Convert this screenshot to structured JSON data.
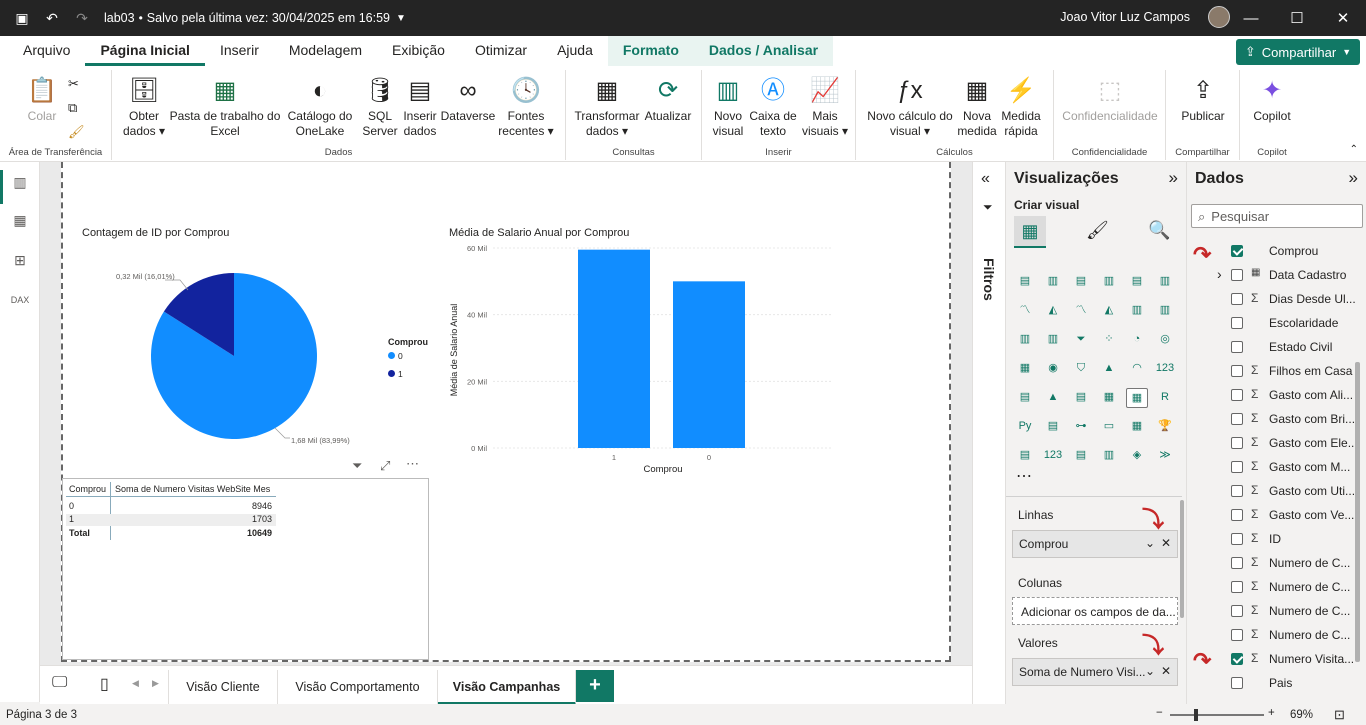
{
  "titlebar": {
    "file": "lab03",
    "saved": "Salvo pela última vez: 30/04/2025 em 16:59",
    "user": "Joao Vitor Luz Campos"
  },
  "tabs": [
    "Arquivo",
    "Página Inicial",
    "Inserir",
    "Modelagem",
    "Exibição",
    "Otimizar",
    "Ajuda",
    "Formato",
    "Dados / Analisar"
  ],
  "share": "Compartilhar",
  "ribbon": {
    "clip": {
      "colar": "Colar",
      "group": "Área de Transferência"
    },
    "dados": {
      "obter": "Obter dados",
      "excel": "Pasta de trabalho do Excel",
      "onelake": "Catálogo do OneLake",
      "sql": "SQL Server",
      "inserir": "Inserir dados",
      "dataverse": "Dataverse",
      "fontes": "Fontes recentes",
      "group": "Dados"
    },
    "consultas": {
      "transformar": "Transformar dados",
      "atualizar": "Atualizar",
      "group": "Consultas"
    },
    "inserir": {
      "novo": "Novo visual",
      "caixa": "Caixa de texto",
      "mais": "Mais visuais",
      "group": "Inserir"
    },
    "calculos": {
      "novocalc": "Novo cálculo do visual",
      "novamedida": "Nova medida",
      "rapida": "Medida rápida",
      "group": "Cálculos"
    },
    "conf": {
      "btn": "Confidencialidade",
      "group": "Confidencialidade"
    },
    "comp": {
      "btn": "Publicar",
      "group": "Compartilhar"
    },
    "copilot": {
      "btn": "Copilot",
      "group": "Copilot"
    }
  },
  "pie": {
    "title": "Contagem de ID por Comprou",
    "label_small": "0,32 Mil (16,01%)",
    "label_big": "1,68 Mil (83,99%)",
    "legend_title": "Comprou",
    "legend": [
      "0",
      "1"
    ]
  },
  "chart_data": [
    {
      "type": "pie",
      "title": "Contagem de ID por Comprou",
      "categories": [
        "0",
        "1"
      ],
      "values": [
        1680,
        320
      ],
      "percent": [
        83.99,
        16.01
      ],
      "colors": [
        "#118dff",
        "#12239e"
      ]
    },
    {
      "type": "bar",
      "title": "Média de Salario Anual por Comprou",
      "categories": [
        "1",
        "0"
      ],
      "values": [
        59500,
        50000
      ],
      "xlabel": "Comprou",
      "ylabel": "Média de Salario Anual",
      "ylim": [
        0,
        60000
      ],
      "yticks": [
        "0 Mil",
        "20 Mil",
        "40 Mil",
        "60 Mil"
      ],
      "color": "#118dff"
    }
  ],
  "bar": {
    "title": "Média de Salario Anual por Comprou",
    "xlabel": "Comprou",
    "ylabel": "Média de Salario Anual"
  },
  "table": {
    "headers": [
      "Comprou",
      "Soma de Numero Visitas WebSite Mes"
    ],
    "rows": [
      [
        "0",
        "8946"
      ],
      [
        "1",
        "1703"
      ]
    ],
    "total": [
      "Total",
      "10649"
    ]
  },
  "pages": [
    "Visão Cliente",
    "Visão Comportamento",
    "Visão Campanhas"
  ],
  "status": {
    "page": "Página 3 de 3",
    "zoom": "69%"
  },
  "filters_label": "Filtros",
  "viz": {
    "title": "Visualizações",
    "create": "Criar visual",
    "linhas": "Linhas",
    "linhas_val": "Comprou",
    "colunas": "Colunas",
    "colunas_ph": "Adicionar os campos de da...",
    "valores": "Valores",
    "valores_val": "Soma de Numero Visi..."
  },
  "data": {
    "title": "Dados",
    "search": "Pesquisar",
    "fields": [
      {
        "name": "Comprou",
        "sigma": "",
        "checked": true
      },
      {
        "name": "Data Cadastro",
        "sigma": "",
        "checked": false,
        "expand": true
      },
      {
        "name": "Dias Desde Ul...",
        "sigma": "Σ",
        "checked": false
      },
      {
        "name": "Escolaridade",
        "sigma": "",
        "checked": false
      },
      {
        "name": "Estado Civil",
        "sigma": "",
        "checked": false
      },
      {
        "name": "Filhos em Casa",
        "sigma": "Σ",
        "checked": false
      },
      {
        "name": "Gasto com Ali...",
        "sigma": "Σ",
        "checked": false
      },
      {
        "name": "Gasto com Bri...",
        "sigma": "Σ",
        "checked": false
      },
      {
        "name": "Gasto com Ele...",
        "sigma": "Σ",
        "checked": false
      },
      {
        "name": "Gasto com M...",
        "sigma": "Σ",
        "checked": false
      },
      {
        "name": "Gasto com Uti...",
        "sigma": "Σ",
        "checked": false
      },
      {
        "name": "Gasto com Ve...",
        "sigma": "Σ",
        "checked": false
      },
      {
        "name": "ID",
        "sigma": "Σ",
        "checked": false
      },
      {
        "name": "Numero de C...",
        "sigma": "Σ",
        "checked": false
      },
      {
        "name": "Numero de C...",
        "sigma": "Σ",
        "checked": false
      },
      {
        "name": "Numero de C...",
        "sigma": "Σ",
        "checked": false
      },
      {
        "name": "Numero de C...",
        "sigma": "Σ",
        "checked": false
      },
      {
        "name": "Numero Visita...",
        "sigma": "Σ",
        "checked": true
      },
      {
        "name": "Pais",
        "sigma": "",
        "checked": false
      }
    ]
  }
}
